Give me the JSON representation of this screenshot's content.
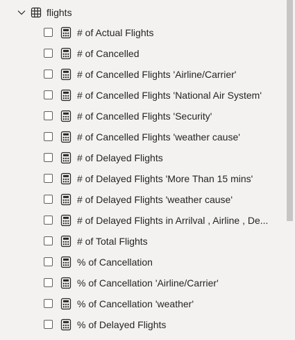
{
  "table": {
    "name": "flights",
    "expanded": true,
    "icon": "table-icon"
  },
  "fields": [
    {
      "label": "# of Actual Flights",
      "icon": "calculator-icon",
      "checked": false
    },
    {
      "label": "# of Cancelled",
      "icon": "calculator-icon",
      "checked": false
    },
    {
      "label": "# of Cancelled Flights 'Airline/Carrier'",
      "icon": "calculator-icon",
      "checked": false
    },
    {
      "label": "# of Cancelled Flights 'National Air System'",
      "icon": "calculator-icon",
      "checked": false
    },
    {
      "label": "# of Cancelled Flights 'Security'",
      "icon": "calculator-icon",
      "checked": false
    },
    {
      "label": "# of Cancelled Flights 'weather cause'",
      "icon": "calculator-icon",
      "checked": false
    },
    {
      "label": "# of Delayed Flights",
      "icon": "calculator-icon",
      "checked": false
    },
    {
      "label": "# of Delayed Flights 'More Than 15 mins'",
      "icon": "calculator-icon",
      "checked": false
    },
    {
      "label": "# of Delayed Flights 'weather cause'",
      "icon": "calculator-icon",
      "checked": false
    },
    {
      "label": "# of Delayed Flights in Arrilval , Airline , De...",
      "icon": "calculator-icon",
      "checked": false
    },
    {
      "label": "# of Total Flights",
      "icon": "calculator-icon",
      "checked": false
    },
    {
      "label": "% of Cancellation",
      "icon": "calculator-icon",
      "checked": false
    },
    {
      "label": "% of Cancellation 'Airline/Carrier'",
      "icon": "calculator-icon",
      "checked": false
    },
    {
      "label": "% of Cancellation 'weather'",
      "icon": "calculator-icon",
      "checked": false
    },
    {
      "label": "% of Delayed Flights",
      "icon": "calculator-icon",
      "checked": false
    }
  ],
  "colors": {
    "background": "#f3f2f1",
    "text": "#252423",
    "icon": "#252423",
    "checkbox_border": "#605e5c",
    "scrollbar_thumb": "#c8c6c4"
  }
}
